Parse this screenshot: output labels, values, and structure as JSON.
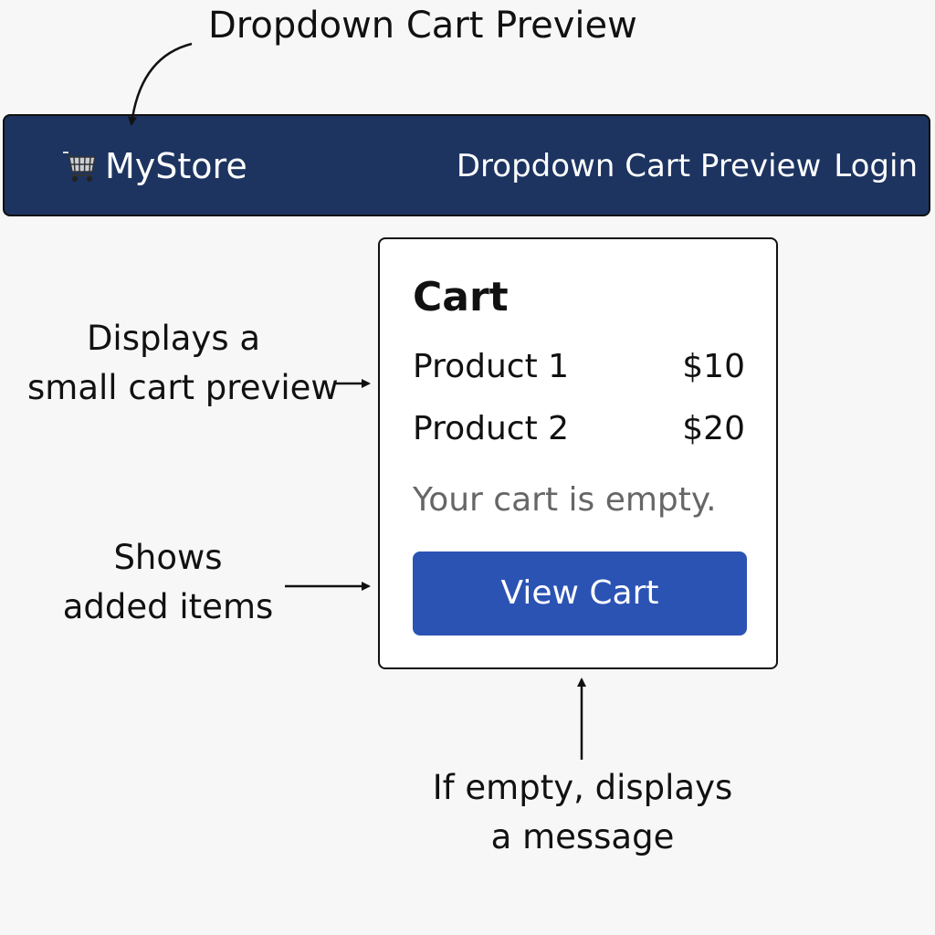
{
  "annotations": {
    "title": "Dropdown Cart Preview",
    "preview_line1": "Displays a",
    "preview_line2": "small cart preview",
    "items_line1": "Shows",
    "items_line2": "added items",
    "empty_line1": "If empty, displays",
    "empty_line2": "a message"
  },
  "navbar": {
    "brand_icon": "shopping-cart-icon",
    "brand_name": "MyStore",
    "links": [
      "Dropdown Cart Preview",
      "Login"
    ],
    "background": "#1d3461"
  },
  "cart": {
    "title": "Cart",
    "items": [
      {
        "name": "Product 1",
        "price": "$10"
      },
      {
        "name": "Product 2",
        "price": "$20"
      }
    ],
    "empty_message": "Your cart is empty.",
    "button_label": "View Cart",
    "button_color": "#2b53b3"
  }
}
